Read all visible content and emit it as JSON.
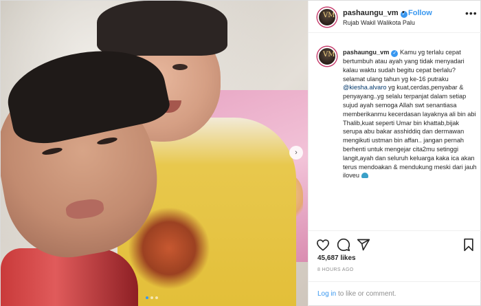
{
  "post": {
    "username": "pashaungu_vm",
    "follow_label": "Follow",
    "separator": "•",
    "location": "Rujab Wakil Walikota Palu",
    "more_label": "•••",
    "caption": {
      "text_part1": "Kamu yg terlalu cepat bertumbuh atau ayah yang tidak menyadari kalau waktu sudah begitu cepat berlalu? selamat ulang tahun yg ke-16 putraku ",
      "mention": "@kiesha.alvaro",
      "text_part2": " yg kuat,cerdas,penyabar & penyayang..yg selalu terpanjat dalam setiap sujud ayah semoga Allah swt senantiasa memberikanmu kecerdasan layaknya ali bin abi Thalib,kuat seperti Umar bin khattab,bijak serupa abu bakar asshiddiq dan dermawan mengikuti ustman bin affan.. jangan pernah berhenti untuk mengejar cita2mu setinggi langit,ayah dan seluruh keluarga kaka ica akan terus mendoakan & mendukung meski dari jauh iloveu "
    },
    "likes": "45,687 likes",
    "timestamp": "8 HOURS AGO",
    "login_link": "Log in",
    "login_rest": " to like or comment.",
    "carousel": {
      "total": 3,
      "active_index": 0
    }
  },
  "icons": {
    "like": "heart-icon",
    "comment": "comment-icon",
    "share": "share-icon",
    "save": "bookmark-icon",
    "next": "chevron-right-icon",
    "verified": "verified-badge-icon"
  },
  "colors": {
    "link_blue": "#3897f0",
    "text": "#262626",
    "muted": "#8e8e8e",
    "mention": "#00376b"
  }
}
